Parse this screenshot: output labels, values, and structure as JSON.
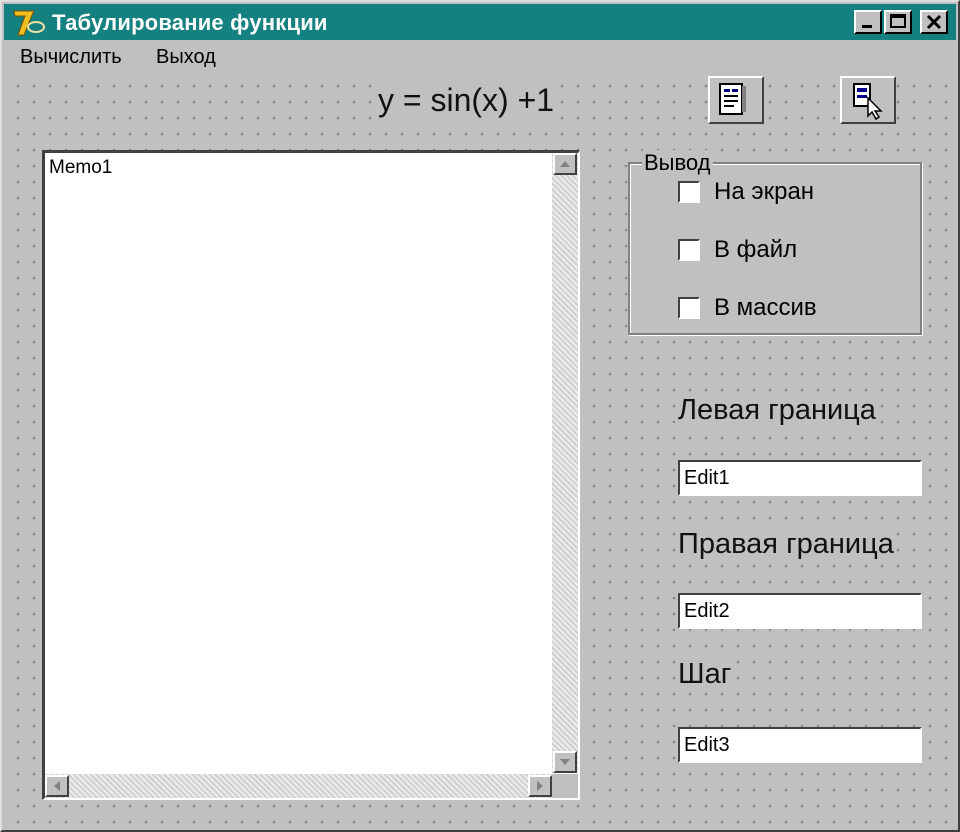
{
  "window": {
    "title": "Табулирование функции"
  },
  "menu": {
    "items": [
      "Вычислить",
      "Выход"
    ]
  },
  "formula": "y = sin(x) +1",
  "toolbar": {
    "buttons": [
      {
        "icon": "report-icon"
      },
      {
        "icon": "run-pointer-icon"
      }
    ]
  },
  "memo": {
    "text": "Memo1"
  },
  "output_group": {
    "caption": "Вывод",
    "options": [
      {
        "label": "На экран",
        "checked": false
      },
      {
        "label": "В файл",
        "checked": false
      },
      {
        "label": "В массив",
        "checked": false
      }
    ]
  },
  "fields": [
    {
      "label": "Левая граница",
      "value": "Edit1"
    },
    {
      "label": "Правая граница",
      "value": "Edit2"
    },
    {
      "label": "Шаг",
      "value": "Edit3"
    }
  ],
  "colors": {
    "titlebar": "#148080",
    "face": "#c0c0c0"
  }
}
